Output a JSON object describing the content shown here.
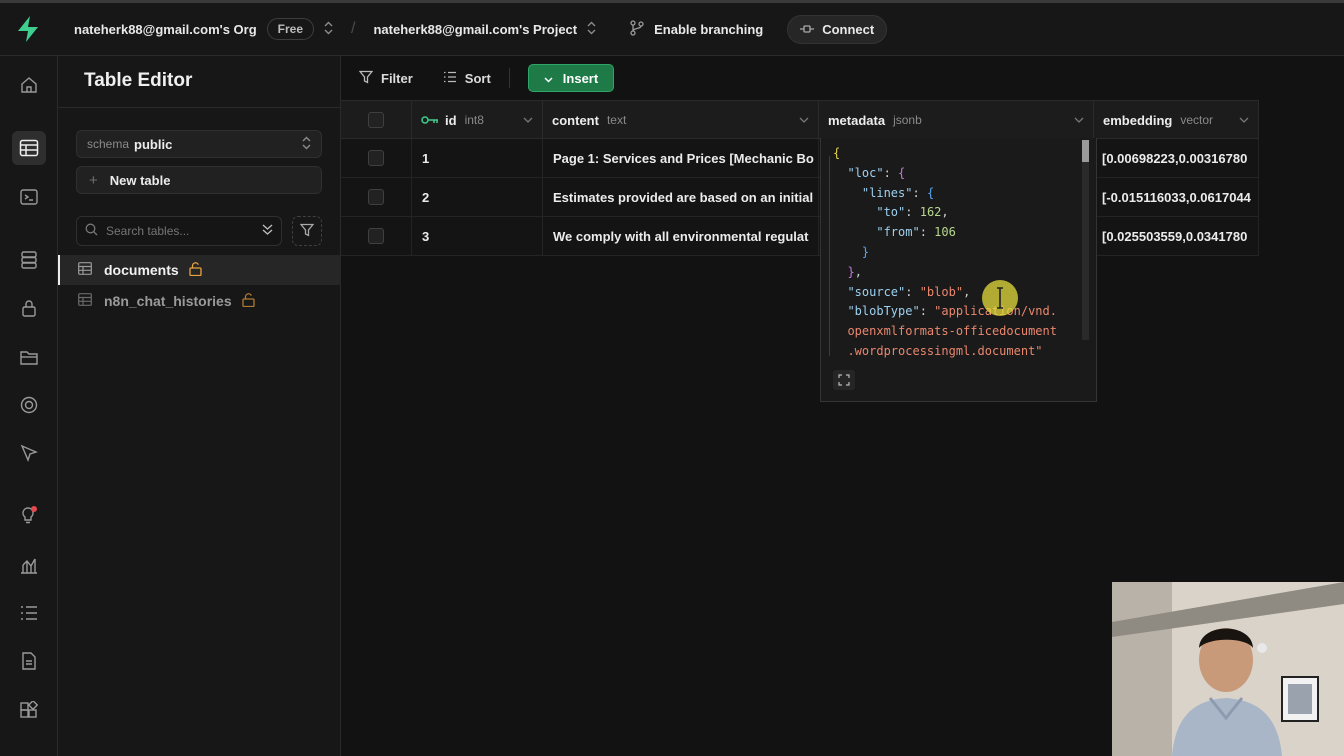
{
  "topbar": {
    "org": "nateherk88@gmail.com's Org",
    "plan": "Free",
    "project": "nateherk88@gmail.com's Project",
    "branching": "Enable branching",
    "connect": "Connect"
  },
  "sidebar": {
    "title": "Table Editor",
    "schema_label": "schema",
    "schema_value": "public",
    "new_table": "New table",
    "search_placeholder": "Search tables...",
    "tables": [
      {
        "name": "documents"
      },
      {
        "name": "n8n_chat_histories"
      }
    ]
  },
  "toolbar": {
    "filter": "Filter",
    "sort": "Sort",
    "insert": "Insert"
  },
  "grid": {
    "columns": [
      {
        "name": "id",
        "type": "int8"
      },
      {
        "name": "content",
        "type": "text"
      },
      {
        "name": "metadata",
        "type": "jsonb"
      },
      {
        "name": "embedding",
        "type": "vector"
      }
    ],
    "rows": [
      {
        "id": "1",
        "content": "Page 1: Services and Prices [Mechanic Bo",
        "embedding": "[0.00698223,0.00316780"
      },
      {
        "id": "2",
        "content": "Estimates provided are based on an initial",
        "embedding": "[-0.015116033,0.0617044"
      },
      {
        "id": "3",
        "content": "We comply with all environmental regulat",
        "embedding": "[0.025503559,0.0341780"
      }
    ]
  },
  "json_popover": {
    "k_loc": "\"loc\"",
    "k_lines": "\"lines\"",
    "k_to": "\"to\"",
    "v_to": "162",
    "k_from": "\"from\"",
    "v_from": "106",
    "k_source": "\"source\"",
    "v_source": "\"blob\"",
    "k_blobtype": "\"blobType\"",
    "v_blobtype_1": "\"application/vnd.",
    "v_blobtype_2": "openxmlformats-officedocument",
    "v_blobtype_3": ".wordprocessingml.document\""
  },
  "colors": {
    "accent_green": "#3ecf8e",
    "insert_green": "#1e7a47",
    "lock_orange": "#e8a33d",
    "notification_red": "#e5484d"
  }
}
